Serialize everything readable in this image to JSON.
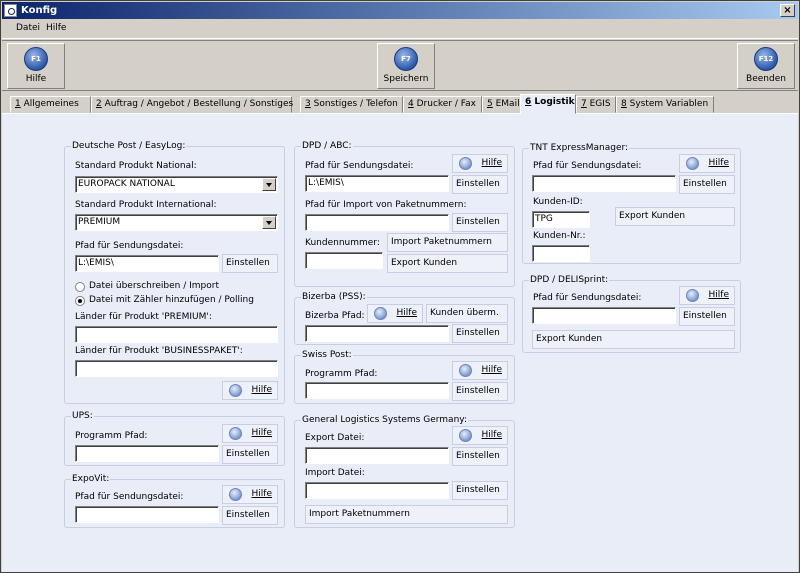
{
  "window": {
    "title": "Konfig",
    "close": "×"
  },
  "menu": [
    "Datei",
    "Hilfe"
  ],
  "toolbar": [
    {
      "key": "F1",
      "label": "Hilfe"
    },
    {
      "key": "F7",
      "label": "Speichern"
    },
    {
      "key": "F12",
      "label": "Beenden"
    }
  ],
  "tabs": [
    {
      "num": "1",
      "label": "Allgemeines"
    },
    {
      "num": "2",
      "label": "Auftrag / Angebot / Bestellung / Sonstiges"
    },
    {
      "num": "3",
      "label": "Sonstiges / Telefon"
    },
    {
      "num": "4",
      "label": "Drucker / Fax"
    },
    {
      "num": "5",
      "label": "EMail"
    },
    {
      "num": "6",
      "label": "Logistik"
    },
    {
      "num": "7",
      "label": "EGIS"
    },
    {
      "num": "8",
      "label": "System Variablen"
    }
  ],
  "active_tab": "6 Logistik",
  "common": {
    "help": "Hilfe",
    "set": "Einstellen"
  },
  "deutsche_post": {
    "title": "Deutsche Post / EasyLog:",
    "national_label": "Standard Produkt National:",
    "national_value": "EUROPACK NATIONAL",
    "international_label": "Standard Produkt International:",
    "international_value": "PREMIUM",
    "path_label": "Pfad für Sendungsdatei:",
    "path_value": "L:\\EMIS\\",
    "radio1": "Datei überschreiben / Import",
    "radio2": "Datei mit Zähler hinzufügen / Polling",
    "premium_label": "Länder für Produkt 'PREMIUM':",
    "premium_value": "",
    "business_label": "Länder für Produkt 'BUSINESSPAKET':",
    "business_value": ""
  },
  "ups": {
    "title": "UPS:",
    "path_label": "Programm Pfad:",
    "path_value": ""
  },
  "expovit": {
    "title": "ExpoVit:",
    "path_label": "Pfad für Sendungsdatei:",
    "path_value": ""
  },
  "dpd_abc": {
    "title": "DPD / ABC:",
    "path_label": "Pfad für Sendungsdatei:",
    "path_value": "L:\\EMIS\\",
    "import_label": "Pfad für Import von Paketnummern:",
    "import_value": "",
    "kunden_label": "Kundennummer:",
    "kunden_value": "",
    "import_btn": "Import Paketnummern",
    "export_btn": "Export Kunden"
  },
  "bizerba": {
    "title": "Bizerba (PSS):",
    "path_label": "Bizerba Pfad:",
    "path_value": "",
    "transfer_btn": "Kunden überm."
  },
  "swiss_post": {
    "title": "Swiss Post:",
    "path_label": "Programm Pfad:",
    "path_value": ""
  },
  "gls": {
    "title": "General Logistics Systems Germany:",
    "export_label": "Export Datei:",
    "export_value": "",
    "import_label": "Import Datei:",
    "import_value": "",
    "import_btn": "Import Paketnummern"
  },
  "tnt": {
    "title": "TNT ExpressManager:",
    "path_label": "Pfad für Sendungsdatei:",
    "path_value": "",
    "kunden_id_label": "Kunden-ID:",
    "kunden_id_value": "TPG",
    "kunden_nr_label": "Kunden-Nr.:",
    "kunden_nr_value": "",
    "export_btn": "Export Kunden"
  },
  "dpd_deli": {
    "title": "DPD / DELISprint:",
    "path_label": "Pfad für Sendungsdatei:",
    "path_value": "",
    "export_btn": "Export Kunden"
  }
}
